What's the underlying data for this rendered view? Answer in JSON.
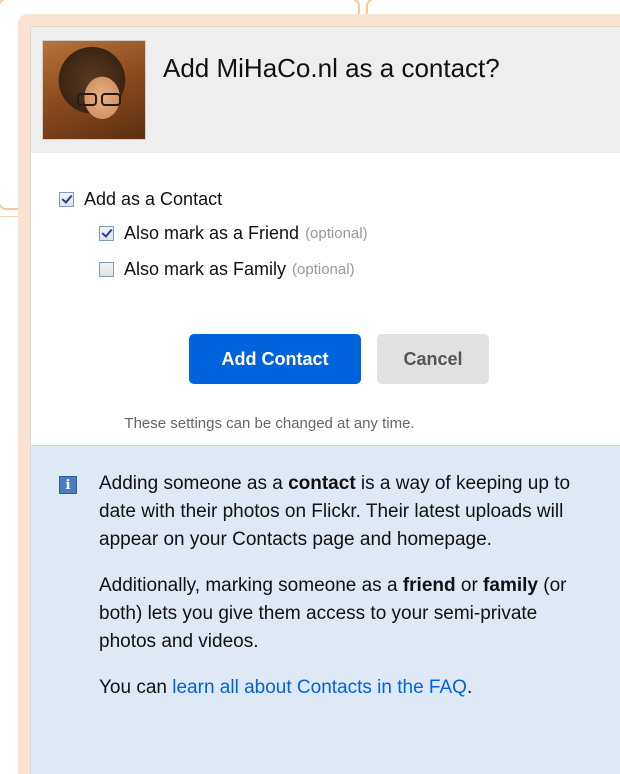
{
  "dialog": {
    "title": "Add MiHaCo.nl as a contact?",
    "avatar_alt": "avatar"
  },
  "options": {
    "contact": {
      "label": "Add as a Contact",
      "checked": true
    },
    "friend": {
      "label": "Also mark as a Friend",
      "optional": "(optional)",
      "checked": true
    },
    "family": {
      "label": "Also mark as Family",
      "optional": "(optional)",
      "checked": false
    }
  },
  "buttons": {
    "add": "Add Contact",
    "cancel": "Cancel"
  },
  "note": "These settings can be changed at any time.",
  "info": {
    "icon": "info-icon",
    "p1": {
      "a": "Adding someone as a ",
      "b": "contact",
      "c": " is a way of keeping up to date with their photos on Flickr. Their latest uploads will appear on your Contacts page and homepage."
    },
    "p2": {
      "a": "Additionally, marking someone as a ",
      "b": "friend",
      "c": " or ",
      "d": "family",
      "e": " (or both) lets you give them access to your semi-private photos and videos."
    },
    "p3": {
      "a": "You can ",
      "link": "learn all about Contacts in the FAQ",
      "c": "."
    }
  },
  "colors": {
    "primary_button": "#0063dc",
    "link": "#0063dc",
    "info_background": "#dfe9f6",
    "frame": "#fbe4cf"
  }
}
